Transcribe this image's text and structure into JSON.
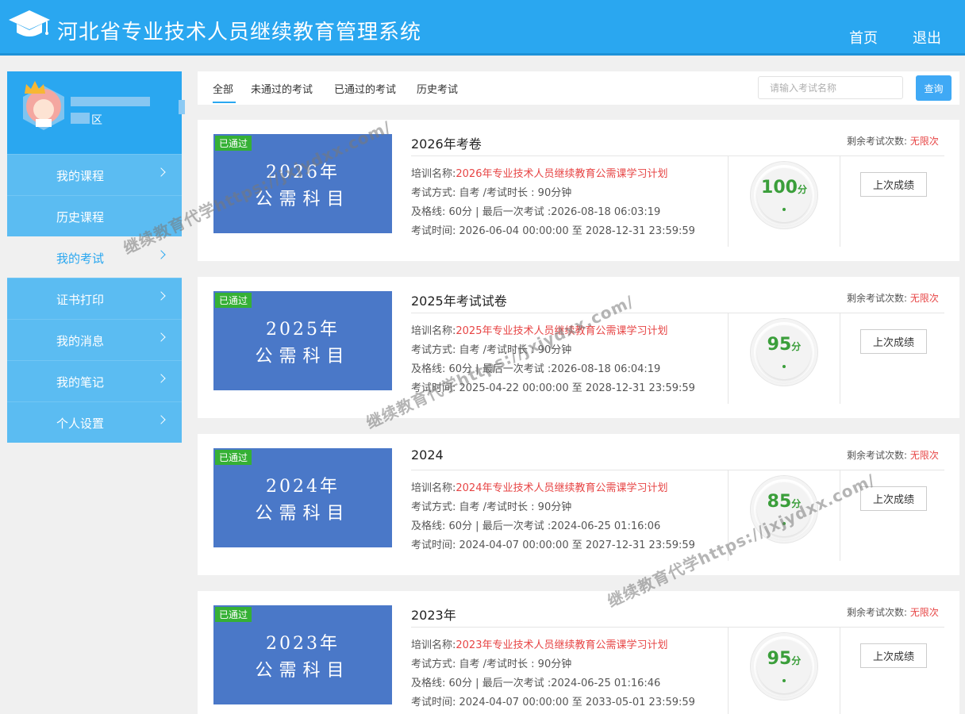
{
  "header": {
    "title": "河北省专业技术人员继续教育管理系统",
    "nav_home": "首页",
    "nav_logout": "退出"
  },
  "sidebar": {
    "profile_area": "区",
    "items": [
      {
        "label": "我的课程"
      },
      {
        "label": "历史课程"
      },
      {
        "label": "我的考试"
      },
      {
        "label": "证书打印"
      },
      {
        "label": "我的消息"
      },
      {
        "label": "我的笔记"
      },
      {
        "label": "个人设置"
      }
    ]
  },
  "tabs": [
    {
      "label": "全部"
    },
    {
      "label": "未通过的考试"
    },
    {
      "label": "已通过的考试"
    },
    {
      "label": "历史考试"
    }
  ],
  "search": {
    "placeholder": "请输入考试名称",
    "button": "查询"
  },
  "labels": {
    "remaining": "剩余考试次数:",
    "unlimited": "无限次",
    "training_name": "培训名称:",
    "exam_mode": "考试方式: 自考 /考试时长 : 90分钟",
    "pass_line_prefix": "及格线: 60分 | 最后一次考试 :",
    "exam_time": "考试时间: ",
    "last_score": "上次成绩",
    "passed_badge": "已通过",
    "score_unit": "分",
    "cover_subject": "公需科目"
  },
  "exams": [
    {
      "cover_year": "2026年",
      "title": "2026年考卷",
      "training": "2026年专业技术人员继续教育公需课学习计划",
      "last_exam": "2026-08-18 06:03:19",
      "exam_time": "2026-06-04 00:00:00 至 2028-12-31 23:59:59",
      "score": "100"
    },
    {
      "cover_year": "2025年",
      "title": "2025年考试试卷",
      "training": "2025年专业技术人员继续教育公需课学习计划",
      "last_exam": "2026-08-18 06:04:19",
      "exam_time": "2025-04-22 00:00:00 至 2028-12-31 23:59:59",
      "score": "95"
    },
    {
      "cover_year": "2024年",
      "title": "2024",
      "training": "2024年专业技术人员继续教育公需课学习计划",
      "last_exam": "2024-06-25 01:16:06",
      "exam_time": "2024-04-07 00:00:00 至 2027-12-31 23:59:59",
      "score": "85"
    },
    {
      "cover_year": "2023年",
      "title": "2023年",
      "training": "2023年专业技术人员继续教育公需课学习计划",
      "last_exam": "2024-06-25 01:16:46",
      "exam_time": "2024-04-07 00:00:00 至 2033-05-01 23:59:59",
      "score": "95"
    }
  ],
  "watermarks": [
    "继续教育代学https://jxjydxx.com/",
    "继续教育代学https://jxjydxx.com/",
    "继续教育代学https://jxjydxx.com/"
  ],
  "colors": {
    "header": "#2aa7f0",
    "sidebar": "#5bbcf2",
    "cover": "#4a78c8",
    "badge": "#35b035",
    "red": "#e74545",
    "score": "#3a9e3a"
  }
}
